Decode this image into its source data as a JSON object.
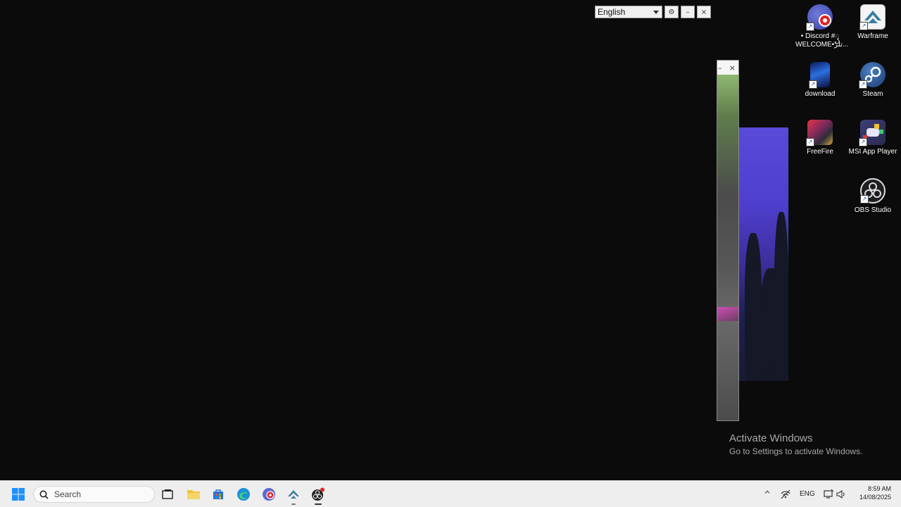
{
  "launcher_bar": {
    "language": "English",
    "settings_glyph": "⚙",
    "minimize_glyph": "–",
    "close_glyph": "×"
  },
  "side_window": {
    "minimize_glyph": "–",
    "close_glyph": "×"
  },
  "desktop_icons": [
    {
      "label": "• Discord #ꦽ WELCOME•ﺗﻠﺮ...",
      "icon": "discord-server-icon"
    },
    {
      "label": "Warframe",
      "icon": "warframe-icon"
    },
    {
      "label": "download",
      "icon": "download-image-icon"
    },
    {
      "label": "Steam",
      "icon": "steam-icon"
    },
    {
      "label": "FreeFire",
      "icon": "freefire-icon"
    },
    {
      "label": "MSI App Player",
      "icon": "msi-app-player-icon"
    },
    {
      "label": "OBS Studio",
      "icon": "obs-studio-icon"
    }
  ],
  "watermark": {
    "title": "Activate Windows",
    "subtitle": "Go to Settings to activate Windows."
  },
  "taskbar": {
    "search_placeholder": "Search",
    "tray": {
      "language": "ENG",
      "time": "8:59 AM",
      "date": "14/08/2025",
      "overflow_glyph": "^"
    }
  },
  "colors": {
    "taskbar_bg": "#eeeeee",
    "desktop_bg": "#0b0b0b",
    "windows_blue": "#1e90ff",
    "discord_red": "#e02424"
  }
}
